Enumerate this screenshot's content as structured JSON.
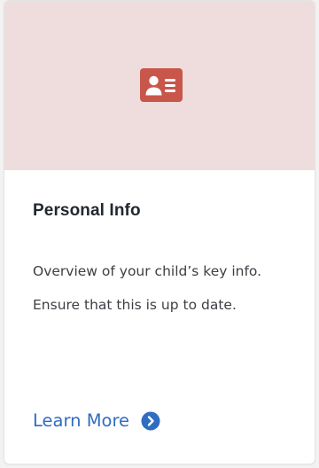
{
  "card": {
    "banner_color": "#efdcdc",
    "icon": "id-card-icon",
    "icon_color": "#c8564a",
    "title": "Personal Info",
    "description": "Overview of your child’s key info. Ensure that this is up to date.",
    "link_label": "Learn More",
    "link_icon": "chevron-right-circle-icon",
    "link_color": "#2f6dc0"
  }
}
